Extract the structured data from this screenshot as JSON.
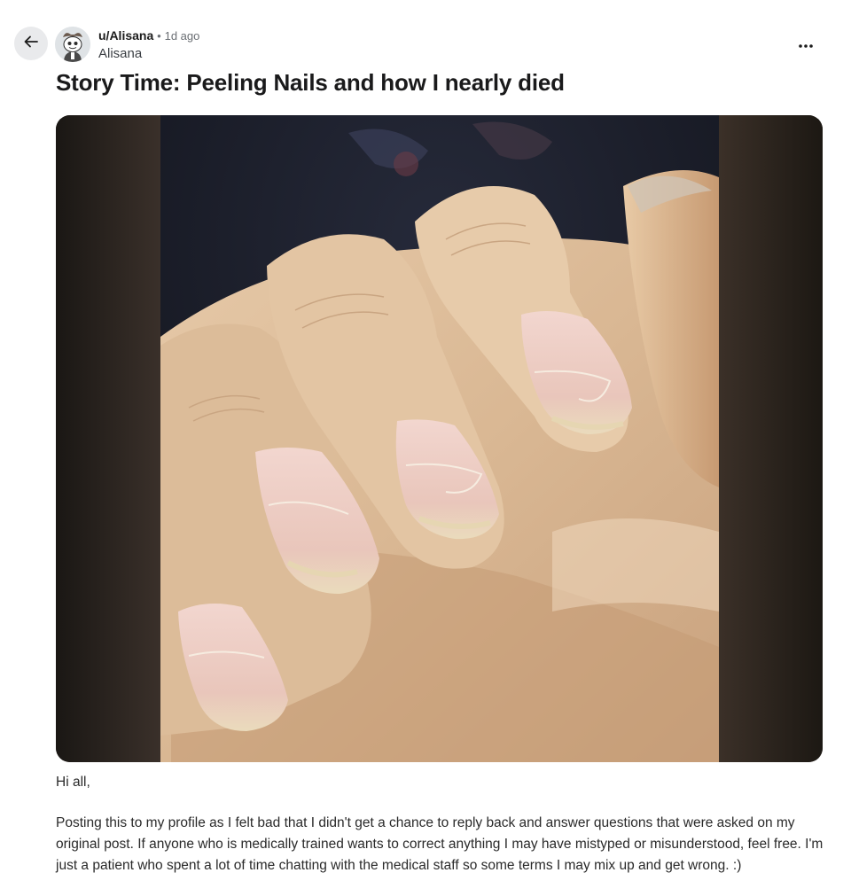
{
  "header": {
    "back_icon": "arrow-left-icon",
    "avatar_icon": "reddit-snoo-avatar",
    "username": "u/Alisana",
    "separator": "•",
    "age": "1d ago",
    "display_name": "Alisana",
    "more_icon": "more-horizontal-icon"
  },
  "post": {
    "title": "Story Time: Peeling Nails and how I nearly died",
    "image_subject": "hand-with-peeling-nails",
    "paragraphs": [
      "Hi all,",
      "Posting this to my profile as I felt bad that I didn't get a chance to reply back and answer questions that were asked on my original post. If anyone who is medically trained wants to correct anything I may have mistyped or misunderstood, feel free. I'm just a patient who spent a lot of time chatting with the medical staff so some terms I may mix up and get wrong. :)"
    ]
  },
  "colors": {
    "back_button_bg": "#e9eaec",
    "text_primary": "#1c1c1c",
    "text_muted": "#6a6e73"
  }
}
